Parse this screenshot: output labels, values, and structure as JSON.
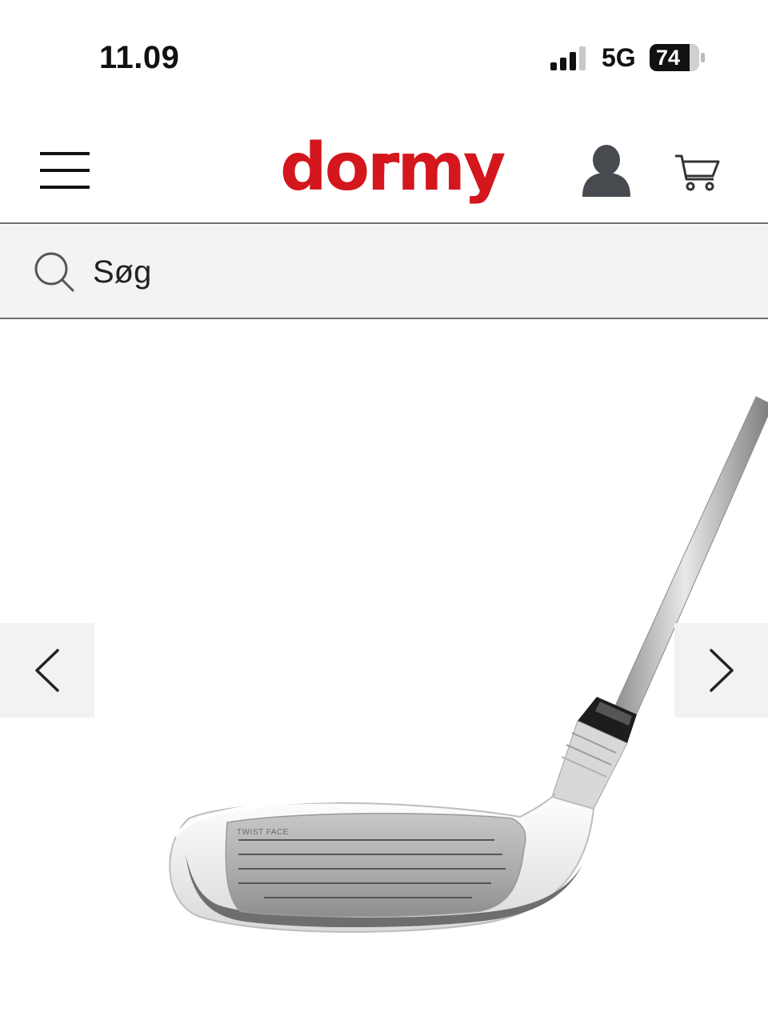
{
  "status_bar": {
    "time": "11.09",
    "network": "5G",
    "battery": "74"
  },
  "header": {
    "logo_text": "dormy",
    "brand_color": "#d4161d"
  },
  "search": {
    "placeholder": "Søg"
  },
  "product": {
    "face_label": "TWIST FACE"
  },
  "icons": {
    "menu": "hamburger-menu-icon",
    "account": "user-icon",
    "cart": "cart-icon",
    "search": "search-icon",
    "prev": "chevron-left-icon",
    "next": "chevron-right-icon"
  }
}
